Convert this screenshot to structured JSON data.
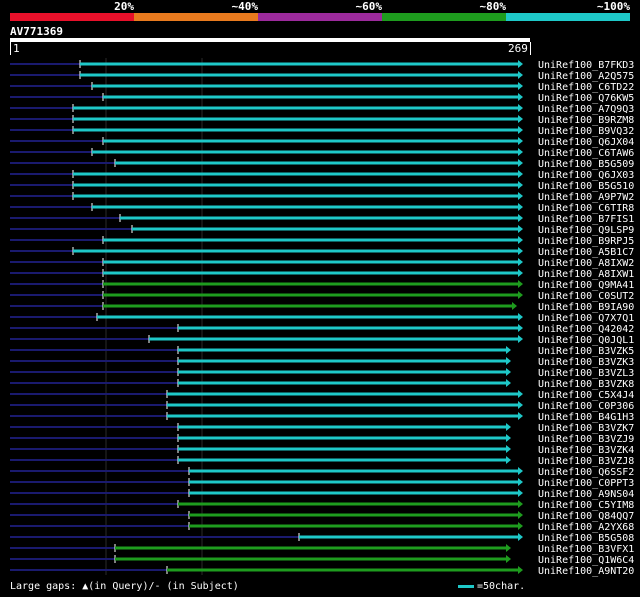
{
  "scale": {
    "labels": [
      "20%",
      "~40%",
      "~60%",
      "~80%",
      "~100%"
    ],
    "colors": [
      "#e8102a",
      "#e87a1e",
      "#9c2a9c",
      "#1e9c1e",
      "#1ec8c8"
    ]
  },
  "query": {
    "id": "AV771369",
    "start": "1",
    "end": "269"
  },
  "colors": {
    "cyan": "#1ec8c8",
    "green": "#1e9c1e",
    "navy": "#1a1a6e"
  },
  "hits": [
    {
      "label": "UniRef100_B7FKD3",
      "start": 80,
      "end": 523,
      "color": "cyan"
    },
    {
      "label": "UniRef100_A2Q575",
      "start": 80,
      "end": 523,
      "color": "cyan"
    },
    {
      "label": "UniRef100_C6TD22",
      "start": 92,
      "end": 523,
      "color": "cyan"
    },
    {
      "label": "UniRef100_Q76KW5",
      "start": 103,
      "end": 523,
      "color": "cyan"
    },
    {
      "label": "UniRef100_A7Q9Q3",
      "start": 73,
      "end": 523,
      "color": "cyan"
    },
    {
      "label": "UniRef100_B9RZM8",
      "start": 73,
      "end": 523,
      "color": "cyan"
    },
    {
      "label": "UniRef100_B9VQ32",
      "start": 73,
      "end": 523,
      "color": "cyan"
    },
    {
      "label": "UniRef100_Q6JX04",
      "start": 103,
      "end": 523,
      "color": "cyan"
    },
    {
      "label": "UniRef100_C6TAW6",
      "start": 92,
      "end": 523,
      "color": "cyan"
    },
    {
      "label": "UniRef100_B5G509",
      "start": 115,
      "end": 523,
      "color": "cyan"
    },
    {
      "label": "UniRef100_Q6JX03",
      "start": 73,
      "end": 523,
      "color": "cyan"
    },
    {
      "label": "UniRef100_B5G510",
      "start": 73,
      "end": 523,
      "color": "cyan"
    },
    {
      "label": "UniRef100_A9P7W2",
      "start": 73,
      "end": 523,
      "color": "cyan"
    },
    {
      "label": "UniRef100_C6TIR8",
      "start": 92,
      "end": 523,
      "color": "cyan"
    },
    {
      "label": "UniRef100_B7FIS1",
      "start": 120,
      "end": 523,
      "color": "cyan"
    },
    {
      "label": "UniRef100_Q9LSP9",
      "start": 132,
      "end": 523,
      "color": "cyan"
    },
    {
      "label": "UniRef100_B9RPJ5",
      "start": 103,
      "end": 523,
      "color": "cyan"
    },
    {
      "label": "UniRef100_A5B1C7",
      "start": 73,
      "end": 523,
      "color": "cyan"
    },
    {
      "label": "UniRef100_A8IXW2",
      "start": 103,
      "end": 523,
      "color": "cyan"
    },
    {
      "label": "UniRef100_A8IXW1",
      "start": 103,
      "end": 523,
      "color": "cyan"
    },
    {
      "label": "UniRef100_Q9MA41",
      "start": 103,
      "end": 523,
      "color": "green"
    },
    {
      "label": "UniRef100_C0SUT2",
      "start": 103,
      "end": 523,
      "color": "green"
    },
    {
      "label": "UniRef100_B9IA90",
      "start": 103,
      "end": 517,
      "color": "green"
    },
    {
      "label": "UniRef100_Q7X7Q1",
      "start": 97,
      "end": 523,
      "color": "cyan"
    },
    {
      "label": "UniRef100_Q42042",
      "start": 178,
      "end": 523,
      "color": "cyan"
    },
    {
      "label": "UniRef100_Q0JQL1",
      "start": 149,
      "end": 523,
      "color": "cyan"
    },
    {
      "label": "UniRef100_B3VZK5",
      "start": 178,
      "end": 511,
      "color": "cyan"
    },
    {
      "label": "UniRef100_B3VZK3",
      "start": 178,
      "end": 511,
      "color": "cyan"
    },
    {
      "label": "UniRef100_B3VZL3",
      "start": 178,
      "end": 511,
      "color": "cyan"
    },
    {
      "label": "UniRef100_B3VZK8",
      "start": 178,
      "end": 511,
      "color": "cyan"
    },
    {
      "label": "UniRef100_C5X4J4",
      "start": 167,
      "end": 523,
      "color": "cyan"
    },
    {
      "label": "UniRef100_C0P306",
      "start": 167,
      "end": 523,
      "color": "cyan"
    },
    {
      "label": "UniRef100_B4G1H3",
      "start": 167,
      "end": 523,
      "color": "cyan"
    },
    {
      "label": "UniRef100_B3VZK7",
      "start": 178,
      "end": 511,
      "color": "cyan"
    },
    {
      "label": "UniRef100_B3VZJ9",
      "start": 178,
      "end": 511,
      "color": "cyan"
    },
    {
      "label": "UniRef100_B3VZK4",
      "start": 178,
      "end": 511,
      "color": "cyan"
    },
    {
      "label": "UniRef100_B3VZJ8",
      "start": 178,
      "end": 511,
      "color": "cyan"
    },
    {
      "label": "UniRef100_Q6SSF2",
      "start": 189,
      "end": 523,
      "color": "cyan"
    },
    {
      "label": "UniRef100_C0PPT3",
      "start": 189,
      "end": 523,
      "color": "cyan"
    },
    {
      "label": "UniRef100_A9NS04",
      "start": 189,
      "end": 523,
      "color": "cyan"
    },
    {
      "label": "UniRef100_C5YIM8",
      "start": 178,
      "end": 523,
      "color": "green"
    },
    {
      "label": "UniRef100_Q84QQ7",
      "start": 189,
      "end": 523,
      "color": "green"
    },
    {
      "label": "UniRef100_A2YX68",
      "start": 189,
      "end": 523,
      "color": "green"
    },
    {
      "label": "UniRef100_B5G508",
      "start": 299,
      "end": 523,
      "color": "cyan"
    },
    {
      "label": "UniRef100_B3VFX1",
      "start": 115,
      "end": 511,
      "color": "green"
    },
    {
      "label": "UniRef100_Q1W6C4",
      "start": 115,
      "end": 511,
      "color": "green"
    },
    {
      "label": "UniRef100_A9NT20",
      "start": 167,
      "end": 523,
      "color": "green"
    }
  ],
  "legend": {
    "text": "Large gaps: ▲(in Query)/- (in Subject)",
    "scale_text": "=50char."
  }
}
